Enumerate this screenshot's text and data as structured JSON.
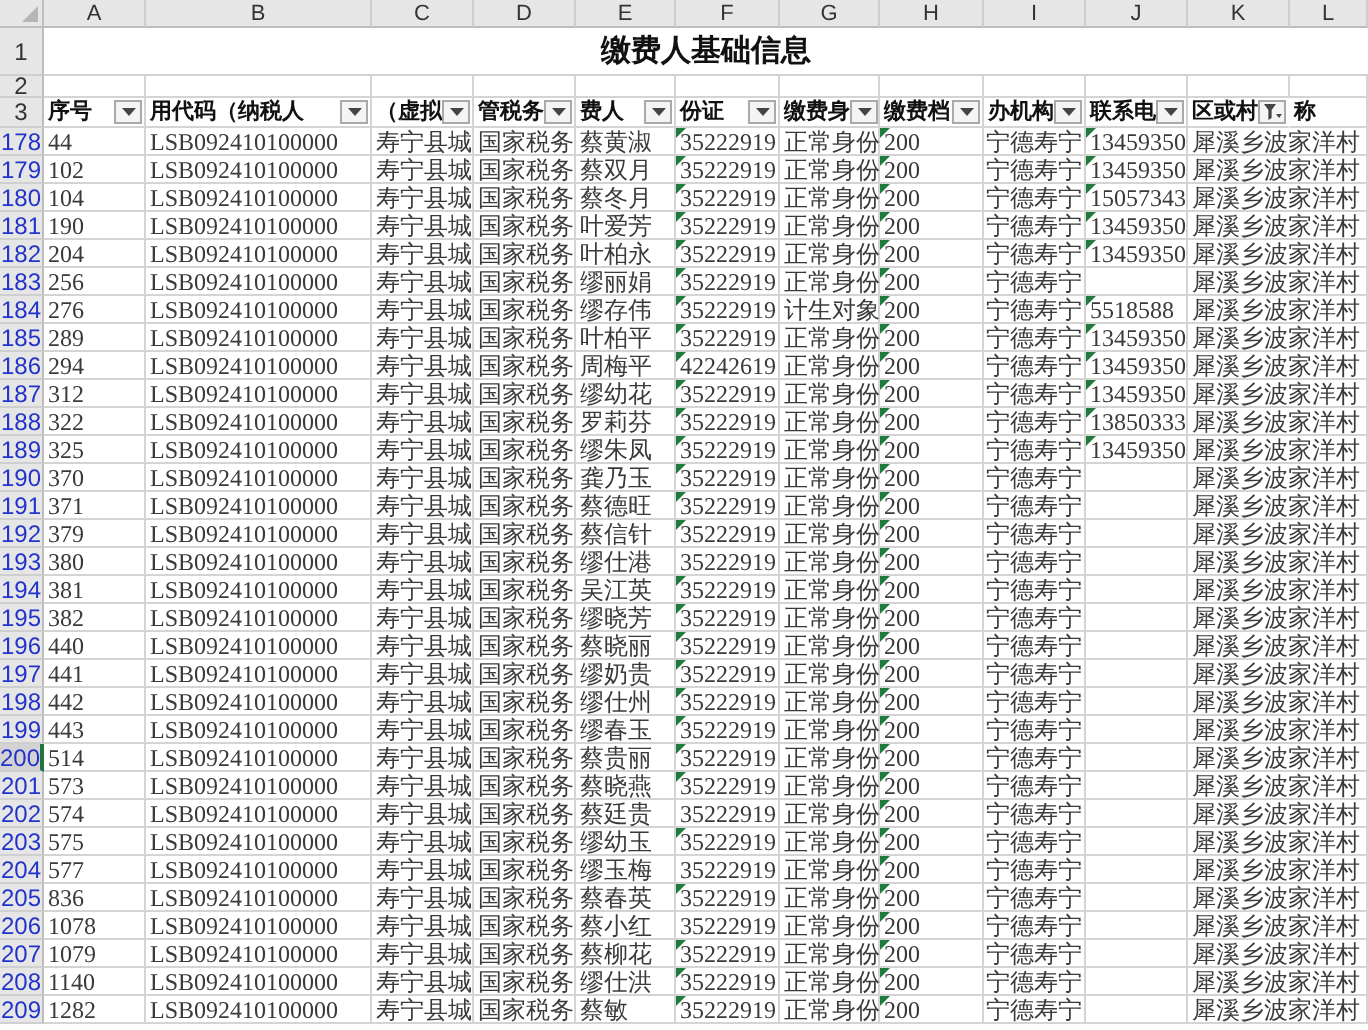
{
  "columns": [
    "A",
    "B",
    "C",
    "D",
    "E",
    "F",
    "G",
    "H",
    "I",
    "J",
    "K",
    "L"
  ],
  "title_row": {
    "num": "1",
    "text": "缴费人基础信息"
  },
  "blank_row": {
    "num": "2"
  },
  "header_row": {
    "num": "3",
    "headers": [
      {
        "text": "序号",
        "kind": "dropdown"
      },
      {
        "text": "用代码（纳税人",
        "kind": "dropdown"
      },
      {
        "text": "（虚拟",
        "kind": "dropdown"
      },
      {
        "text": "管税务",
        "kind": "dropdown"
      },
      {
        "text": "费人",
        "kind": "dropdown"
      },
      {
        "text": "份证",
        "kind": "dropdown"
      },
      {
        "text": "缴费身",
        "kind": "dropdown"
      },
      {
        "text": "缴费档",
        "kind": "dropdown"
      },
      {
        "text": "办机构",
        "kind": "dropdown"
      },
      {
        "text": "联系电",
        "kind": "dropdown"
      },
      {
        "text": "区或村",
        "kind": "filtered"
      },
      {
        "text": "称",
        "kind": "plain"
      }
    ]
  },
  "rows": [
    {
      "num": "178",
      "selected": false,
      "a": "44",
      "b": "LSB092410100000",
      "c": "寿宁县城",
      "d": "国家税务",
      "e": "蔡黄淑",
      "f": "35222919",
      "f_flag": true,
      "g": "正常身份",
      "h": "200",
      "h_flag": true,
      "i": "宁德寿宁",
      "j": "13459350",
      "j_flag": true,
      "k": "犀溪乡波家洋村"
    },
    {
      "num": "179",
      "selected": false,
      "a": "102",
      "b": "LSB092410100000",
      "c": "寿宁县城",
      "d": "国家税务",
      "e": "蔡双月",
      "f": "35222919",
      "f_flag": true,
      "g": "正常身份",
      "h": "200",
      "h_flag": true,
      "i": "宁德寿宁",
      "j": "13459350",
      "j_flag": true,
      "k": "犀溪乡波家洋村"
    },
    {
      "num": "180",
      "selected": false,
      "a": "104",
      "b": "LSB092410100000",
      "c": "寿宁县城",
      "d": "国家税务",
      "e": "蔡冬月",
      "f": "35222919",
      "f_flag": true,
      "g": "正常身份",
      "h": "200",
      "h_flag": true,
      "i": "宁德寿宁",
      "j": "15057343",
      "j_flag": true,
      "k": "犀溪乡波家洋村"
    },
    {
      "num": "181",
      "selected": false,
      "a": "190",
      "b": "LSB092410100000",
      "c": "寿宁县城",
      "d": "国家税务",
      "e": "叶爱芳",
      "f": "35222919",
      "f_flag": true,
      "g": "正常身份",
      "h": "200",
      "h_flag": true,
      "i": "宁德寿宁",
      "j": "13459350",
      "j_flag": true,
      "k": "犀溪乡波家洋村"
    },
    {
      "num": "182",
      "selected": false,
      "a": "204",
      "b": "LSB092410100000",
      "c": "寿宁县城",
      "d": "国家税务",
      "e": "叶柏永",
      "f": "35222919",
      "f_flag": true,
      "g": "正常身份",
      "h": "200",
      "h_flag": true,
      "i": "宁德寿宁",
      "j": "13459350",
      "j_flag": true,
      "k": "犀溪乡波家洋村"
    },
    {
      "num": "183",
      "selected": false,
      "a": "256",
      "b": "LSB092410100000",
      "c": "寿宁县城",
      "d": "国家税务",
      "e": "缪丽娟",
      "f": "35222919",
      "f_flag": true,
      "g": "正常身份",
      "h": "200",
      "h_flag": true,
      "i": "宁德寿宁",
      "k": "犀溪乡波家洋村"
    },
    {
      "num": "184",
      "selected": false,
      "a": "276",
      "b": "LSB092410100000",
      "c": "寿宁县城",
      "d": "国家税务",
      "e": "缪存伟",
      "f": "35222919",
      "f_flag": true,
      "g": "计生对象",
      "h": "200",
      "h_flag": true,
      "i": "宁德寿宁",
      "j": "5518588",
      "j_flag": true,
      "k": "犀溪乡波家洋村"
    },
    {
      "num": "185",
      "selected": false,
      "a": "289",
      "b": "LSB092410100000",
      "c": "寿宁县城",
      "d": "国家税务",
      "e": "叶柏平",
      "f": "35222919",
      "f_flag": true,
      "g": "正常身份",
      "h": "200",
      "h_flag": true,
      "i": "宁德寿宁",
      "j": "13459350",
      "j_flag": true,
      "k": "犀溪乡波家洋村"
    },
    {
      "num": "186",
      "selected": false,
      "a": "294",
      "b": "LSB092410100000",
      "c": "寿宁县城",
      "d": "国家税务",
      "e": "周梅平",
      "f": "42242619",
      "f_flag": true,
      "g": "正常身份",
      "h": "200",
      "h_flag": true,
      "i": "宁德寿宁",
      "j": "13459350",
      "j_flag": true,
      "k": "犀溪乡波家洋村"
    },
    {
      "num": "187",
      "selected": false,
      "a": "312",
      "b": "LSB092410100000",
      "c": "寿宁县城",
      "d": "国家税务",
      "e": "缪幼花",
      "f": "35222919",
      "f_flag": true,
      "g": "正常身份",
      "h": "200",
      "h_flag": true,
      "i": "宁德寿宁",
      "j": "13459350",
      "j_flag": true,
      "k": "犀溪乡波家洋村"
    },
    {
      "num": "188",
      "selected": false,
      "a": "322",
      "b": "LSB092410100000",
      "c": "寿宁县城",
      "d": "国家税务",
      "e": "罗莉芬",
      "f": "35222919",
      "f_flag": true,
      "g": "正常身份",
      "h": "200",
      "h_flag": true,
      "i": "宁德寿宁",
      "j": "13850333",
      "j_flag": true,
      "k": "犀溪乡波家洋村"
    },
    {
      "num": "189",
      "selected": false,
      "a": "325",
      "b": "LSB092410100000",
      "c": "寿宁县城",
      "d": "国家税务",
      "e": "缪朱凤",
      "f": "35222919",
      "f_flag": true,
      "g": "正常身份",
      "h": "200",
      "h_flag": true,
      "i": "宁德寿宁",
      "j": "13459350",
      "j_flag": true,
      "k": "犀溪乡波家洋村"
    },
    {
      "num": "190",
      "selected": false,
      "a": "370",
      "b": "LSB092410100000",
      "c": "寿宁县城",
      "d": "国家税务",
      "e": "龚乃玉",
      "f": "35222919",
      "f_flag": true,
      "g": "正常身份",
      "h": "200",
      "h_flag": true,
      "i": "宁德寿宁",
      "k": "犀溪乡波家洋村"
    },
    {
      "num": "191",
      "selected": false,
      "a": "371",
      "b": "LSB092410100000",
      "c": "寿宁县城",
      "d": "国家税务",
      "e": "蔡德旺",
      "f": "35222919",
      "f_flag": true,
      "g": "正常身份",
      "h": "200",
      "h_flag": true,
      "i": "宁德寿宁",
      "k": "犀溪乡波家洋村"
    },
    {
      "num": "192",
      "selected": false,
      "a": "379",
      "b": "LSB092410100000",
      "c": "寿宁县城",
      "d": "国家税务",
      "e": "蔡信针",
      "f": "35222919",
      "f_flag": true,
      "g": "正常身份",
      "h": "200",
      "h_flag": true,
      "i": "宁德寿宁",
      "k": "犀溪乡波家洋村"
    },
    {
      "num": "193",
      "selected": false,
      "a": "380",
      "b": "LSB092410100000",
      "c": "寿宁县城",
      "d": "国家税务",
      "e": "缪仕港",
      "f": "35222919",
      "f_flag": false,
      "g": "正常身份",
      "h": "200",
      "h_flag": true,
      "i": "宁德寿宁",
      "k": "犀溪乡波家洋村"
    },
    {
      "num": "194",
      "selected": false,
      "a": "381",
      "b": "LSB092410100000",
      "c": "寿宁县城",
      "d": "国家税务",
      "e": "吴江英",
      "f": "35222919",
      "f_flag": true,
      "g": "正常身份",
      "h": "200",
      "h_flag": true,
      "i": "宁德寿宁",
      "k": "犀溪乡波家洋村"
    },
    {
      "num": "195",
      "selected": false,
      "a": "382",
      "b": "LSB092410100000",
      "c": "寿宁县城",
      "d": "国家税务",
      "e": "缪晓芳",
      "f": "35222919",
      "f_flag": true,
      "g": "正常身份",
      "h": "200",
      "h_flag": true,
      "i": "宁德寿宁",
      "k": "犀溪乡波家洋村"
    },
    {
      "num": "196",
      "selected": false,
      "a": "440",
      "b": "LSB092410100000",
      "c": "寿宁县城",
      "d": "国家税务",
      "e": "蔡晓丽",
      "f": "35222919",
      "f_flag": true,
      "g": "正常身份",
      "h": "200",
      "h_flag": true,
      "i": "宁德寿宁",
      "k": "犀溪乡波家洋村"
    },
    {
      "num": "197",
      "selected": false,
      "a": "441",
      "b": "LSB092410100000",
      "c": "寿宁县城",
      "d": "国家税务",
      "e": "缪奶贵",
      "f": "35222919",
      "f_flag": true,
      "g": "正常身份",
      "h": "200",
      "h_flag": true,
      "i": "宁德寿宁",
      "k": "犀溪乡波家洋村"
    },
    {
      "num": "198",
      "selected": false,
      "a": "442",
      "b": "LSB092410100000",
      "c": "寿宁县城",
      "d": "国家税务",
      "e": "缪仕州",
      "f": "35222919",
      "f_flag": true,
      "g": "正常身份",
      "h": "200",
      "h_flag": true,
      "i": "宁德寿宁",
      "k": "犀溪乡波家洋村"
    },
    {
      "num": "199",
      "selected": false,
      "a": "443",
      "b": "LSB092410100000",
      "c": "寿宁县城",
      "d": "国家税务",
      "e": "缪春玉",
      "f": "35222919",
      "f_flag": true,
      "g": "正常身份",
      "h": "200",
      "h_flag": true,
      "i": "宁德寿宁",
      "k": "犀溪乡波家洋村"
    },
    {
      "num": "200",
      "selected": true,
      "a": "514",
      "b": "LSB092410100000",
      "c": "寿宁县城",
      "d": "国家税务",
      "e": "蔡贵丽",
      "f": "35222919",
      "f_flag": true,
      "g": "正常身份",
      "h": "200",
      "h_flag": true,
      "i": "宁德寿宁",
      "k": "犀溪乡波家洋村"
    },
    {
      "num": "201",
      "selected": false,
      "a": "573",
      "b": "LSB092410100000",
      "c": "寿宁县城",
      "d": "国家税务",
      "e": "蔡晓燕",
      "f": "35222919",
      "f_flag": true,
      "g": "正常身份",
      "h": "200",
      "h_flag": true,
      "i": "宁德寿宁",
      "k": "犀溪乡波家洋村"
    },
    {
      "num": "202",
      "selected": false,
      "a": "574",
      "b": "LSB092410100000",
      "c": "寿宁县城",
      "d": "国家税务",
      "e": "蔡廷贵",
      "f": "35222919",
      "f_flag": false,
      "g": "正常身份",
      "h": "200",
      "h_flag": true,
      "i": "宁德寿宁",
      "k": "犀溪乡波家洋村"
    },
    {
      "num": "203",
      "selected": false,
      "a": "575",
      "b": "LSB092410100000",
      "c": "寿宁县城",
      "d": "国家税务",
      "e": "缪幼玉",
      "f": "35222919",
      "f_flag": true,
      "g": "正常身份",
      "h": "200",
      "h_flag": true,
      "i": "宁德寿宁",
      "k": "犀溪乡波家洋村"
    },
    {
      "num": "204",
      "selected": false,
      "a": "577",
      "b": "LSB092410100000",
      "c": "寿宁县城",
      "d": "国家税务",
      "e": "缪玉梅",
      "f": "35222919",
      "f_flag": false,
      "g": "正常身份",
      "h": "200",
      "h_flag": true,
      "i": "宁德寿宁",
      "k": "犀溪乡波家洋村"
    },
    {
      "num": "205",
      "selected": false,
      "a": "836",
      "b": "LSB092410100000",
      "c": "寿宁县城",
      "d": "国家税务",
      "e": "蔡春英",
      "f": "35222919",
      "f_flag": true,
      "g": "正常身份",
      "h": "200",
      "h_flag": true,
      "i": "宁德寿宁",
      "k": "犀溪乡波家洋村"
    },
    {
      "num": "206",
      "selected": false,
      "a": "1078",
      "b": "LSB092410100000",
      "c": "寿宁县城",
      "d": "国家税务",
      "e": "蔡小红",
      "f": "35222919",
      "f_flag": false,
      "g": "正常身份",
      "h": "200",
      "h_flag": true,
      "i": "宁德寿宁",
      "k": "犀溪乡波家洋村"
    },
    {
      "num": "207",
      "selected": false,
      "a": "1079",
      "b": "LSB092410100000",
      "c": "寿宁县城",
      "d": "国家税务",
      "e": "蔡柳花",
      "f": "35222919",
      "f_flag": true,
      "g": "正常身份",
      "h": "200",
      "h_flag": true,
      "i": "宁德寿宁",
      "k": "犀溪乡波家洋村"
    },
    {
      "num": "208",
      "selected": false,
      "a": "1140",
      "b": "LSB092410100000",
      "c": "寿宁县城",
      "d": "国家税务",
      "e": "缪仕洪",
      "f": "35222919",
      "f_flag": true,
      "g": "正常身份",
      "h": "200",
      "h_flag": true,
      "i": "宁德寿宁",
      "k": "犀溪乡波家洋村"
    },
    {
      "num": "209",
      "selected": false,
      "a": "1282",
      "b": "LSB092410100000",
      "c": "寿宁县城",
      "d": "国家税务",
      "e": "蔡敏",
      "f": "35222919",
      "f_flag": true,
      "g": "正常身份",
      "h": "200",
      "h_flag": true,
      "i": "宁德寿宁",
      "k": "犀溪乡波家洋村"
    }
  ]
}
